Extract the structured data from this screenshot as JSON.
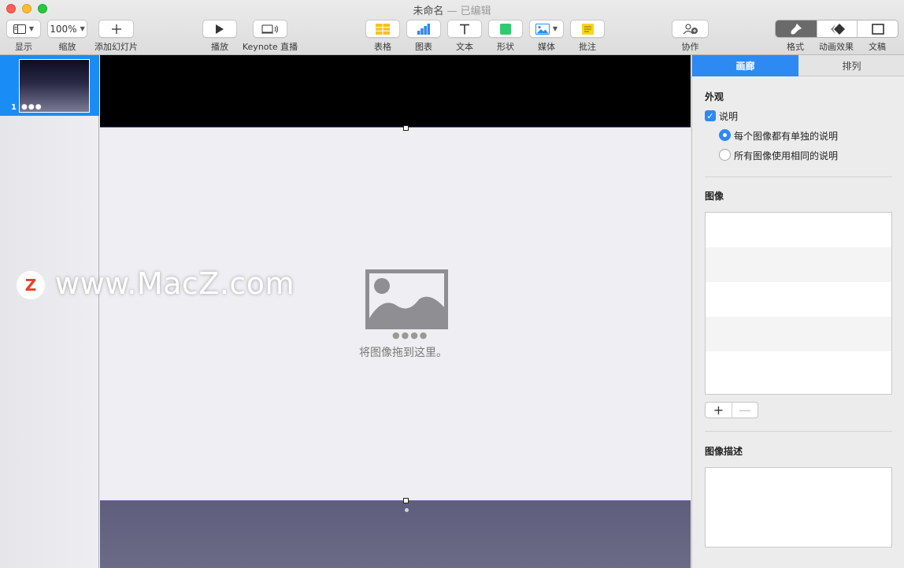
{
  "window": {
    "title": "未命名",
    "edited": " — 已编辑"
  },
  "toolbar": {
    "view_label": "显示",
    "zoom_value": "100%",
    "zoom_label": "缩放",
    "add_slide_label": "添加幻灯片",
    "play_label": "播放",
    "live_label": "Keynote 直播",
    "table_label": "表格",
    "chart_label": "图表",
    "text_label": "文本",
    "shape_label": "形状",
    "media_label": "媒体",
    "comment_label": "批注",
    "collab_label": "协作",
    "format_label": "格式",
    "animate_label": "动画效果",
    "document_label": "文稿"
  },
  "sidebar": {
    "slides": [
      {
        "number": "1",
        "dots": "●●●"
      }
    ]
  },
  "canvas": {
    "placeholder_dots": "●●●●",
    "placeholder_text": "将图像拖到这里。"
  },
  "watermark": {
    "logo_letter": "Z",
    "text": "www.MacZ.com"
  },
  "inspector": {
    "tabs": {
      "gallery": "画廊",
      "arrange": "排列"
    },
    "appearance": {
      "title": "外观",
      "caption_label": "说明",
      "caption_checked": true,
      "radio_unique": "每个图像都有单独的说明",
      "radio_same": "所有图像使用相同的说明",
      "selected_radio": "unique"
    },
    "images": {
      "title": "图像",
      "add_label": "+",
      "remove_label": "—"
    },
    "description": {
      "title": "图像描述",
      "value": ""
    }
  },
  "colors": {
    "accent": "#2d8af3",
    "selection": "#1a8cf5",
    "close": "#fe5f57",
    "minimize": "#febc2e",
    "zoom": "#28c840"
  }
}
